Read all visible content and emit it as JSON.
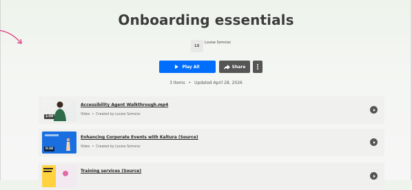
{
  "page": {
    "title": "Onboarding essentials",
    "owner_initials": "LS",
    "owner_name": "Louise Szmoisz",
    "play_all_label": "Play All",
    "share_label": "Share",
    "items_count": "3 Items",
    "updated": "Updated April 28, 2026",
    "meta_separator": "•"
  },
  "entries": [
    {
      "title": "Accessibility Agent Walkthrough.mp4",
      "type": "Video",
      "created": "Created by Louise Szmoisz",
      "duration": "1:59"
    },
    {
      "title": "Enhancing Corporate Events with Kaltura (Source)",
      "type": "Video",
      "created": "Created by Louise Szmoisz",
      "duration": "0:38"
    },
    {
      "title": "Training services (Source)",
      "type": "",
      "created": "",
      "duration": ""
    }
  ],
  "colors": {
    "primary_button": "#006efa",
    "secondary_button": "#555555",
    "accent_arrow": "#e0307a"
  },
  "icons": {
    "play_all": "play-icon",
    "share": "share-arrow-icon",
    "more": "more-vertical-icon",
    "row_play": "play-circle-icon"
  }
}
